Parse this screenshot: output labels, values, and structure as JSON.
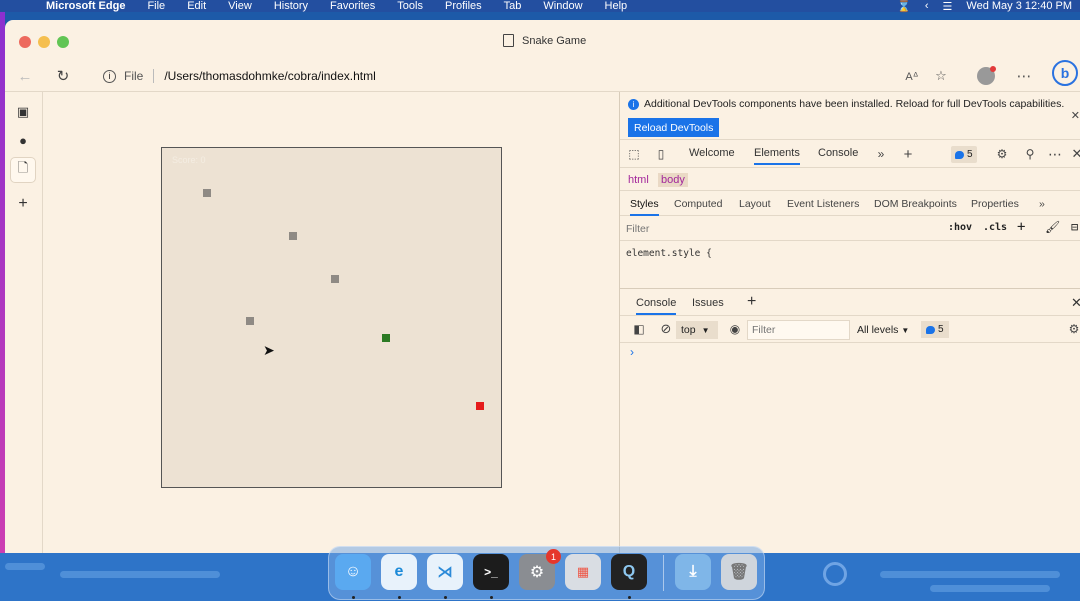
{
  "menubar": {
    "app_name": "Microsoft Edge",
    "items": [
      "File",
      "Edit",
      "View",
      "History",
      "Favorites",
      "Tools",
      "Profiles",
      "Tab",
      "Window",
      "Help"
    ],
    "datetime": "Wed May 3  12:40 PM"
  },
  "window": {
    "title": "Snake Game"
  },
  "toolbar": {
    "site_label": "File",
    "url": "/Users/thomasdohmke/cobra/index.html"
  },
  "game": {
    "score_label": "Score: 0",
    "colors": {
      "snake": "#8f8a84",
      "head": "#2c7a23",
      "food": "#e51b1b",
      "board": "#ede2d3"
    }
  },
  "devtools": {
    "banner_text": "Additional DevTools components have been installed. Reload for full DevTools capabilities.",
    "reload_button": "Reload DevTools",
    "tabs": [
      "Welcome",
      "Elements",
      "Console"
    ],
    "active_tab": "Elements",
    "message_count": "5",
    "breadcrumbs": [
      "html",
      "body"
    ],
    "subtabs": [
      "Styles",
      "Computed",
      "Layout",
      "Event Listeners",
      "DOM Breakpoints",
      "Properties"
    ],
    "filter_placeholder": "Filter",
    "hov": ":hov",
    "cls": ".cls",
    "element_style": "element.style {",
    "drawer_tabs": [
      "Console",
      "Issues"
    ],
    "console_context": "top",
    "console_filter_placeholder": "Filter",
    "levels": "All levels",
    "console_count": "5",
    "prompt": "›"
  }
}
